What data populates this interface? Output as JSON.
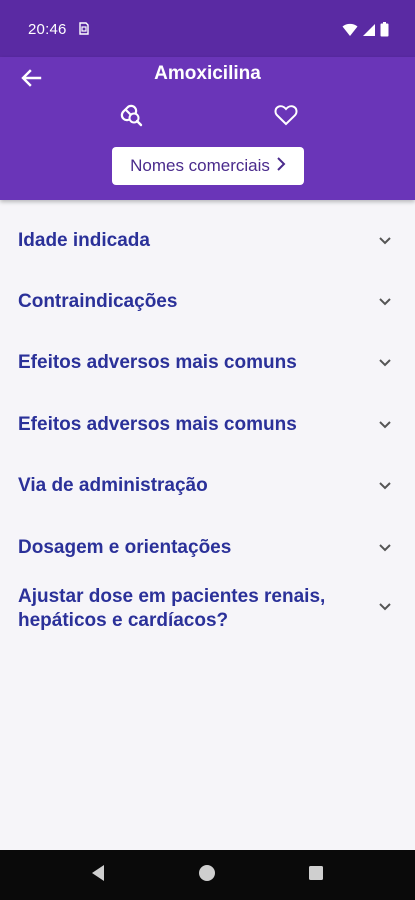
{
  "status_bar": {
    "time": "20:46",
    "icons": [
      "sim-card-icon",
      "wifi-icon",
      "signal-icon",
      "battery-icon"
    ]
  },
  "header": {
    "title": "Amoxicilina",
    "back_icon": "arrow-back-icon",
    "actions": [
      "pill-search-icon",
      "heart-icon"
    ],
    "brand_names_button": "Nomes comerciais",
    "colors": {
      "status_bar": "#5a2aa3",
      "app_bar": "#6a35b8",
      "button_text": "#4a2b8c"
    }
  },
  "sections": [
    {
      "label": "Idade indicada"
    },
    {
      "label": "Contraindicações"
    },
    {
      "label": "Efeitos adversos mais comuns"
    },
    {
      "label": "Efeitos adversos mais comuns"
    },
    {
      "label": "Via de administração"
    },
    {
      "label": "Dosagem e orientações"
    },
    {
      "label": "Ajustar dose em pacientes renais, hepáticos e cardíacos?"
    }
  ],
  "section_text_color": "#2b3199",
  "nav_bar": {
    "buttons": [
      "back-triangle-icon",
      "home-circle-icon",
      "recents-square-icon"
    ]
  }
}
